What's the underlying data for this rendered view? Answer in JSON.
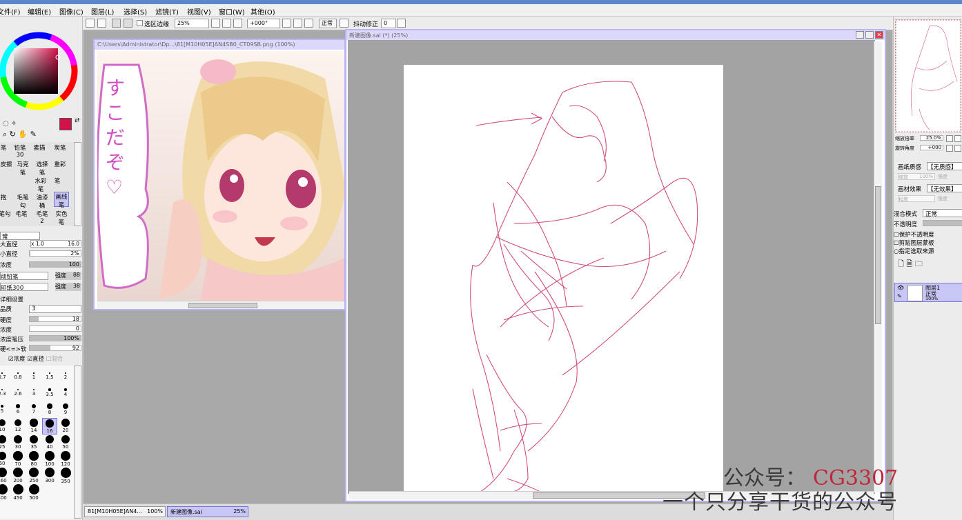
{
  "menu": [
    "文件(F)",
    "编辑(E)",
    "图像(C)",
    "图层(L)",
    "选择(S)",
    "滤镜(T)",
    "视图(V)",
    "窗口(W)",
    "其他(O)"
  ],
  "toolbar": {
    "selection_edge_label": "选区边缘",
    "zoom_value": "25%",
    "rotation_value": "+000°",
    "blend_value": "正常",
    "stabilizer_label": "抖动修正",
    "stabilizer_value": "0"
  },
  "colors": {
    "primary": "#d4124a",
    "secondary": "#6a8fd0",
    "accent": "#b9b5f5"
  },
  "brushes": [
    [
      "笔",
      "铅笔30",
      "素描",
      "炭笔"
    ],
    [
      "皮擦",
      "马克笔",
      "选择笔",
      "重彩"
    ],
    [
      "",
      "水彩笔",
      "笔",
      ""
    ],
    [
      "抱",
      "毛笔勾",
      "油漆桶",
      "画线笔"
    ],
    [
      "笔勾",
      "毛笔",
      "毛笔2",
      "实色笔"
    ]
  ],
  "brush_settings": {
    "mode": "常",
    "size_label": "大直径",
    "size_mult": "x 1.0",
    "size_value": "16.0",
    "min_size_label": "小直径",
    "min_size_value": "2%",
    "density_label": "浓度",
    "density_value": "100",
    "shape_name": "动铅笔",
    "shape_strength_label": "强度",
    "shape_strength": "88",
    "texture_name": "印纸300",
    "texture_strength_label": "强度",
    "texture_strength": "38",
    "advanced_label": "详细设置",
    "quality_label": "品质",
    "quality_value": "3",
    "hardness_label": "硬度",
    "hardness_value": "18",
    "min_density_label": "浓度",
    "min_density_value": "0",
    "pressure_label": "浓度笔压",
    "pressure_value": "100%",
    "hard_soft_label": "硬<=>软",
    "hard_soft_value": "92",
    "pressure_density_label": "浓度",
    "pressure_size_label": "直径",
    "pressure_blend_label": "混合"
  },
  "size_presets": [
    "0.7",
    "0.8",
    "1",
    "1.5",
    "2",
    "2.3",
    "2.6",
    "3",
    "3.5",
    "4",
    "5",
    "6",
    "7",
    "8",
    "9",
    "10",
    "12",
    "14",
    "16",
    "20",
    "25",
    "30",
    "35",
    "40",
    "50",
    "60",
    "70",
    "80",
    "100",
    "120",
    "160",
    "200",
    "250",
    "300",
    "350",
    "400",
    "450",
    "500"
  ],
  "windows": {
    "reference_title": "C:\\Users\\Administrator\\Dp...\\81[M10H05E]AN4SB0_CT09SB.png (100%)",
    "reference_text": "すこだぞ♡",
    "canvas_title": "新建图像.sai (*) (25%)"
  },
  "right_panel": {
    "zoom_label": "缩放倍率",
    "zoom_value": "25.0%",
    "rotation_label": "旋转角度",
    "rotation_value": "+000",
    "paper_texture_label": "画纸质感",
    "paper_texture_value": "【无质感】",
    "paper_scale_label": "缩放",
    "paper_scale_value": "100%",
    "paper_strength_label": "强度",
    "paper_effect_label": "画材效果",
    "paper_effect_value": "【无效果】",
    "effect_strength_label": "程度",
    "effect_strength2_label": "强度",
    "blend_mode_label": "混合模式",
    "blend_mode_value": "正常",
    "opacity_label": "不透明度",
    "preserve_opacity": "保护不透明度",
    "clipping": "剪贴图层蒙板",
    "selection_source": "指定选取来源",
    "layer_name": "图层1",
    "layer_mode": "正常",
    "layer_opacity": "100%"
  },
  "taskbar": [
    {
      "label": "81[M10H05E]AN4...",
      "zoom": "100%"
    },
    {
      "label": "新建图像.sai",
      "zoom": "25%"
    }
  ],
  "watermark": {
    "line1": "公众号：",
    "line1_code": "CG3307",
    "line2": "一个只分享干货的公众号"
  }
}
